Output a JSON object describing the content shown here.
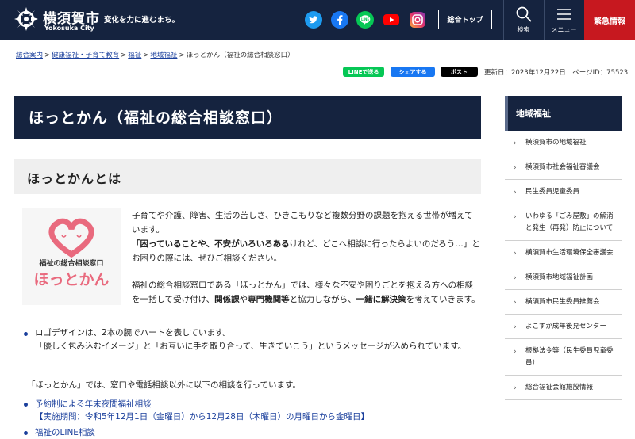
{
  "header": {
    "city_name": "横須賀市",
    "city_name_en": "Yokosuka City",
    "slogan": "変化を力に進むまち。",
    "social": [
      "twitter-icon",
      "facebook-icon",
      "line-icon",
      "youtube-icon",
      "instagram-icon"
    ],
    "top_button": "総合トップ",
    "search_label": "検索",
    "menu_label": "メニュー",
    "emergency_label": "緊急情報",
    "colors": {
      "navy": "#15233f",
      "emergency": "#c7181f"
    }
  },
  "breadcrumb": [
    "総合案内",
    "健康福祉・子育て教育",
    "福祉",
    "地域福祉",
    "ほっとかん（福祉の総合相談窓口）"
  ],
  "share": {
    "line": "LINEで送る",
    "facebook": "シェアする",
    "x": "ポスト"
  },
  "meta": {
    "updated": "更新日：2023年12月22日",
    "page_id": "ページID：75523"
  },
  "main": {
    "title": "ほっとかん（福祉の総合相談窓口）",
    "heading": "ほっとかんとは",
    "logo_caption": "福祉の総合相談窓口",
    "logo_text": "ほっとかん",
    "p1_a": "子育てや介護、障害、生活の苦しさ、ひきこもりなど複数分野の課題を抱える世帯が増えています。",
    "p1_b": "「困っていることや、不安がいろいろある",
    "p1_c": "けれど、どこへ相談に行ったらよいのだろう…」とお困りの際には、ぜひご相談ください。",
    "p2_a": "福祉の総合相談窓口である「ほっとかん」では、様々な不安や困りごとを抱える方への相談を一括して受け付け、",
    "p2_b": "関係課",
    "p2_c": "や",
    "p2_d": "専門機関等",
    "p2_e": "と協力しながら、",
    "p2_f": "一緒に解決策",
    "p2_g": "を考えていきます。",
    "bullet_1": "ロゴデザインは、2本の腕でハートを表しています。",
    "bullet_2": "「優しく包み込むイメージ」と「お互いに手を取り合って、生きていこう」というメッセージが込められています。",
    "intro": "「ほっとかん」では、窓口や電話相談以外に以下の相談を行っています。",
    "link_1a": "予約制による年末夜間福祉相談",
    "link_1b": "【実施期間：令和5年12月1日（金曜日）から12月28日（木曜日）の月曜日から金曜日】",
    "link_2": "福祉のLINE相談"
  },
  "sidebar": {
    "title": "地域福祉",
    "items": [
      "横須賀市の地域福祉",
      "横須賀市社会福祉審議会",
      "民生委員児童委員",
      "いわゆる「ごみ屋敷」の解消と発生（再発）防止について",
      "横須賀市生活環境保全審議会",
      "横須賀市地域福祉計画",
      "横須賀市民生委員推薦会",
      "よこすか成年後見センター",
      "根拠法令等（民生委員児童委員）",
      "総合福祉会館施設情報"
    ]
  }
}
